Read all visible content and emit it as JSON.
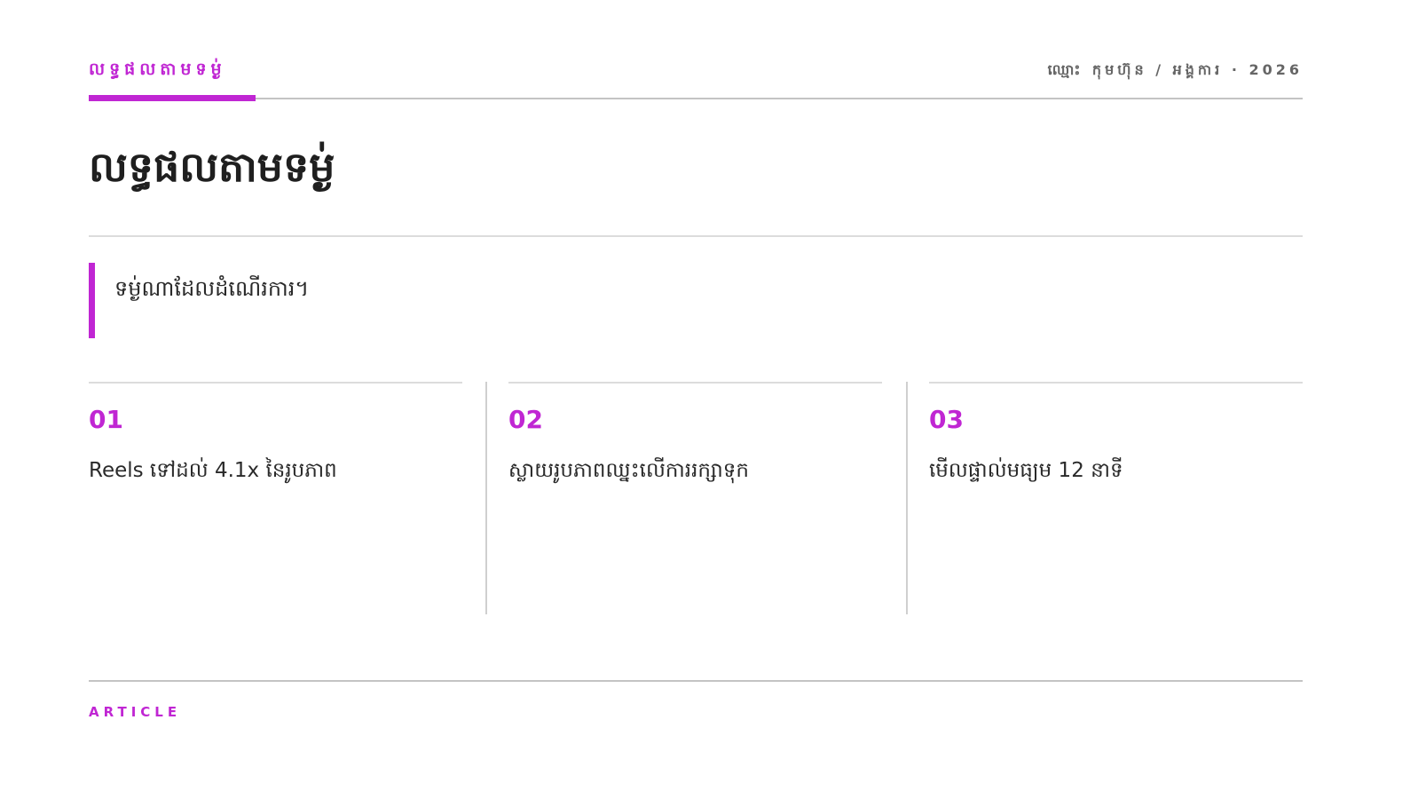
{
  "header": {
    "kicker": "លទ្ធផលតាមទម្ង់",
    "meta": "ឈ្មោះ កុមហ៊ុន / អង្គការ · 2026"
  },
  "title": "លទ្ធផលតាមទម្ង់",
  "quote": "ទម្ង់ណាដែលដំណើរការ។",
  "columns": [
    {
      "number": "01",
      "text": "Reels ទៅដល់ 4.1x នៃរូបភាព"
    },
    {
      "number": "02",
      "text": "ស្លាយរូបភាពឈ្នះលើការរក្សាទុក"
    },
    {
      "number": "03",
      "text": "មើលផ្ទាល់មធ្យម 12 នាទី"
    }
  ],
  "footer": {
    "label": "ARTICLE"
  },
  "colors": {
    "accent": "#c026d3",
    "text": "#222222",
    "muted": "#666666",
    "rule": "#c4c4c4"
  }
}
